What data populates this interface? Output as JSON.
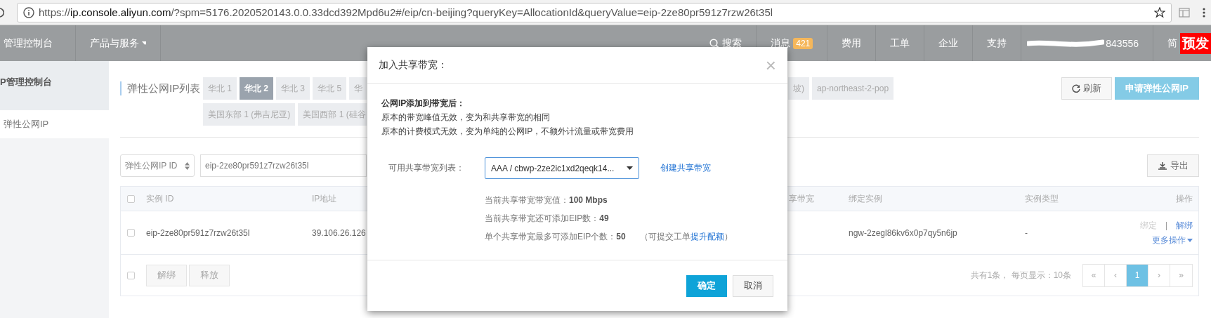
{
  "browser": {
    "url_host": "ip.console.aliyun.com",
    "url_prefix": "https://",
    "url_rest": "/?spm=5176.2020520143.0.0.33dcd392Mpd6u2#/eip/cn-beijing?queryKey=AllocationId&queryValue=eip-2ze80pr591z7rzw26t35l"
  },
  "top_nav": {
    "left": [
      {
        "label": "管理控制台",
        "kind": "plain"
      },
      {
        "label": "产品与服务",
        "kind": "dropdown"
      }
    ],
    "right": [
      {
        "label": "搜索",
        "kind": "search"
      },
      {
        "label": "消息",
        "kind": "badge",
        "badge": "421"
      },
      {
        "label": "费用",
        "kind": "plain"
      },
      {
        "label": "工单",
        "kind": "plain"
      },
      {
        "label": "企业",
        "kind": "plain"
      },
      {
        "label": "支持",
        "kind": "plain"
      },
      {
        "label": "843556",
        "kind": "account"
      },
      {
        "label": "简",
        "kind": "plain"
      }
    ],
    "env_badge": "预发"
  },
  "sidebar": {
    "title": "P管理控制台",
    "items": [
      {
        "label": "弹性公网IP",
        "selected": true
      }
    ]
  },
  "page_title": "弹性公网IP列表",
  "region_tabs": {
    "row_1": [
      {
        "label": "华北 1",
        "selected": false
      },
      {
        "label": "华北 2",
        "selected": true
      },
      {
        "label": "华北 3",
        "selected": false
      },
      {
        "label": "华北 5",
        "selected": false
      },
      {
        "label": "华",
        "selected": false
      }
    ],
    "row_2": [
      {
        "label": "美国东部 1 (弗吉尼亚)",
        "selected": false
      },
      {
        "label": "美国西部 1 (硅谷",
        "selected": false
      }
    ],
    "row_1_right": [
      {
        "label": "坡)",
        "selected": false
      },
      {
        "label": "ap-northeast-2-pop",
        "selected": false
      }
    ]
  },
  "actions": {
    "refresh": "刷新",
    "create": "申请弹性公网IP",
    "export": "导出"
  },
  "search": {
    "key": "弹性公网IP ID",
    "value": "eip-2ze80pr591z7rzw26t35l"
  },
  "table": {
    "columns_left": [
      "实例 ID",
      "IP地址"
    ],
    "columns_right": [
      "享带宽",
      "绑定实例",
      "实例类型",
      "操作"
    ],
    "rows": [
      {
        "checked": false,
        "instance_id": "eip-2ze80pr591z7rzw26t35l",
        "ip": "39.106.26.126",
        "bound_instance": "ngw-2zegl86kv6x0p7qy5n6jp",
        "instance_type": "-",
        "actions": [
          {
            "label": "绑定",
            "disabled": true
          },
          {
            "label": "解绑",
            "disabled": false
          }
        ],
        "separator": "|",
        "more": "更多操作"
      }
    ],
    "header_checked": false,
    "footer": {
      "checked": false,
      "buttons": [
        {
          "label": "解绑",
          "disabled": true
        },
        {
          "label": "释放",
          "disabled": true
        }
      ],
      "summary": "共有1条， 每页显示：10条",
      "pages": [
        {
          "label": "«",
          "selected": false
        },
        {
          "label": "‹",
          "selected": false
        },
        {
          "label": "1",
          "selected": true
        },
        {
          "label": "›",
          "selected": false
        },
        {
          "label": "»",
          "selected": false
        }
      ]
    }
  },
  "dialog": {
    "title": "加入共享带宽：",
    "close": "×",
    "heading": "公网IP添加到带宽后：",
    "lines": [
      "原本的带宽峰值无效，变为和共享带宽的相同",
      "原本的计费模式无效，变为单纯的公网IP，不额外计流量或带宽费用"
    ],
    "field_label": "可用共享带宽列表：",
    "select_value": "AAA / cbwp-2ze2ic1xd2qeqk14...",
    "create_link": "创建共享带宽",
    "info": [
      "当前共享带宽带宽值：**100 Mbps**",
      "当前共享带宽还可添加EIP数：**49**",
      "单个共享带宽最多可添加EIP个数：**50**"
    ],
    "note": {
      "before": "（可提交工单",
      "link": "提升配额",
      "after": "）"
    },
    "ok": "确定",
    "cancel": "取消"
  }
}
